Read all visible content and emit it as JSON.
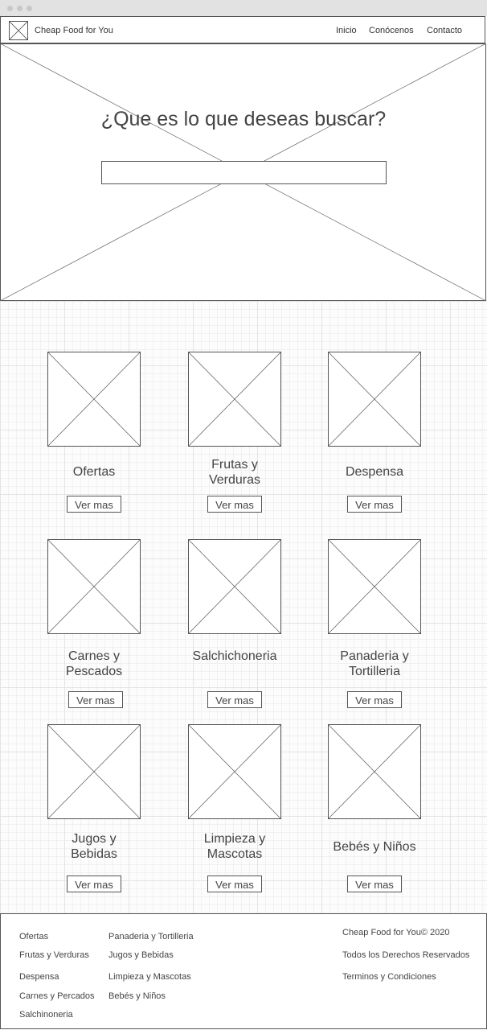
{
  "navbar": {
    "brand": "Cheap Food for You",
    "links": [
      "Inicio",
      "Conócenos",
      "Contacto"
    ]
  },
  "hero": {
    "title": "¿Que es lo que deseas buscar?",
    "search_value": "",
    "search_placeholder": ""
  },
  "categories": [
    {
      "title": "Ofertas",
      "button": "Ver mas"
    },
    {
      "title": "Frutas y Verduras",
      "button": "Ver mas"
    },
    {
      "title": "Despensa",
      "button": "Ver mas"
    },
    {
      "title": "Carnes y Pescados",
      "button": "Ver mas"
    },
    {
      "title": "Salchichoneria",
      "button": "Ver mas"
    },
    {
      "title": "Panaderia y Tortilleria",
      "button": "Ver mas"
    },
    {
      "title": "Jugos y Bebidas",
      "button": "Ver mas"
    },
    {
      "title": "Limpieza y Mascotas",
      "button": "Ver mas"
    },
    {
      "title": "Bebés y Niños",
      "button": "Ver mas"
    }
  ],
  "footer": {
    "col1": [
      "Ofertas",
      "Frutas y Verduras",
      "Despensa",
      "Carnes y Percados",
      "Salchinoneria"
    ],
    "col2": [
      "Panaderia y Tortilleria",
      "Jugos y Bebidas",
      "Limpieza y Mascotas",
      "Bebés y Niños"
    ],
    "copyright": "Cheap Food for You© 2020",
    "rights": "Todos los Derechos Reservados",
    "terms": "Terminos y Condiciones"
  }
}
